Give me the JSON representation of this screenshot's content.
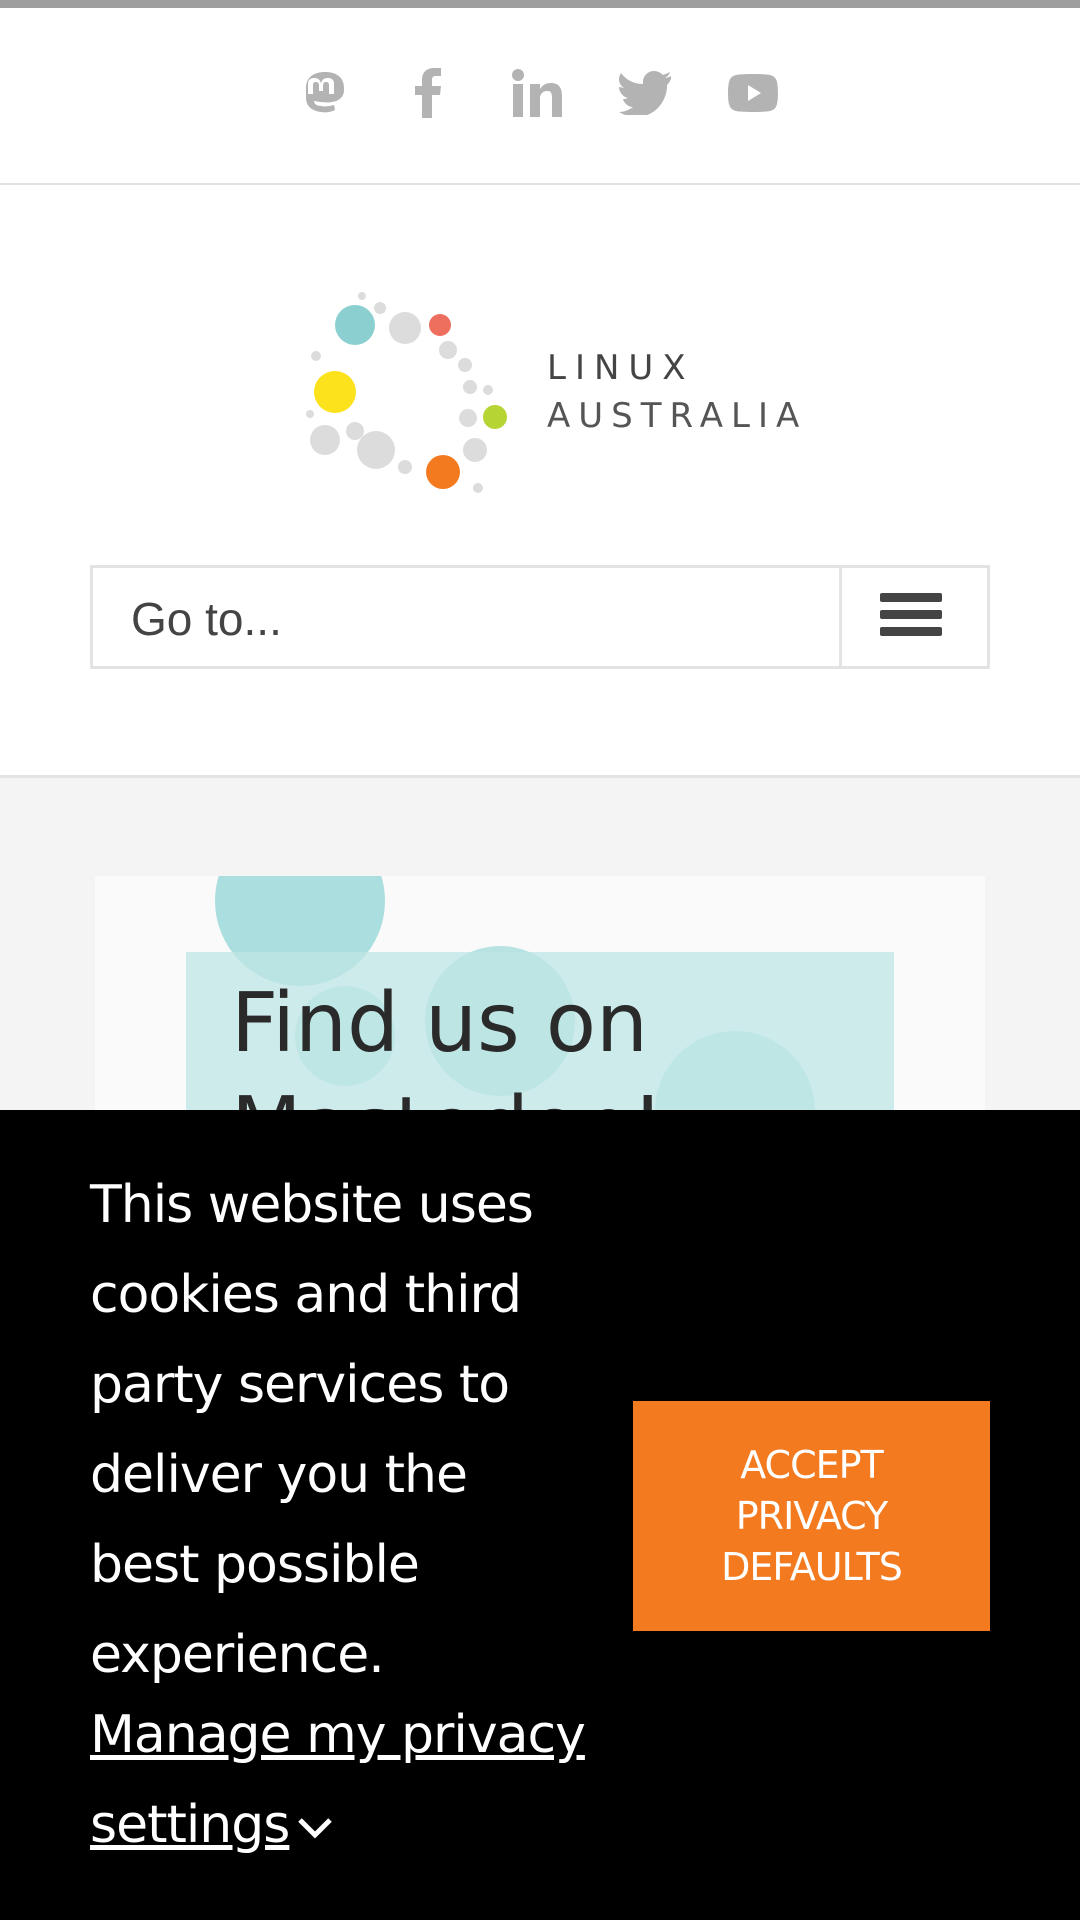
{
  "social": {
    "icons": [
      "mastodon-icon",
      "facebook-icon",
      "linkedin-icon",
      "twitter-icon",
      "youtube-icon"
    ],
    "icon_color": "#b3b3b3"
  },
  "logo": {
    "line1": "LINUX",
    "line2": "AUSTRALIA"
  },
  "nav": {
    "label": "Go to...",
    "menu_icon": "hamburger-icon"
  },
  "card": {
    "title": "Find us on Mastodon!"
  },
  "cookie_banner": {
    "message": "This website uses cookies and third party services to deliver you the best possible experience.",
    "manage_link": "Manage my privacy settings",
    "accept_button": "ACCEPT PRIVACY DEFAULTS",
    "accent_color": "#f47a20"
  }
}
